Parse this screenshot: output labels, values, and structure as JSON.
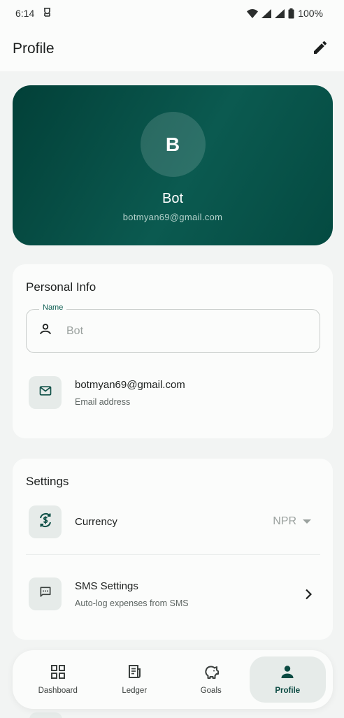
{
  "status_bar": {
    "time": "6:14",
    "battery": "100%"
  },
  "app_bar": {
    "title": "Profile"
  },
  "profile": {
    "avatar_initial": "B",
    "name": "Bot",
    "email": "botmyan69@gmail.com"
  },
  "personal_info": {
    "title": "Personal Info",
    "name_field": {
      "label": "Name",
      "placeholder": "Bot"
    },
    "email_row": {
      "value": "botmyan69@gmail.com",
      "caption": "Email address"
    }
  },
  "settings": {
    "title": "Settings",
    "currency": {
      "label": "Currency",
      "value": "NPR"
    },
    "sms": {
      "label": "SMS Settings",
      "caption": "Auto-log expenses from SMS"
    }
  },
  "bottom_nav": {
    "items": [
      {
        "label": "Dashboard",
        "icon": "grid-icon"
      },
      {
        "label": "Ledger",
        "icon": "receipt-icon"
      },
      {
        "label": "Goals",
        "icon": "piggy-bank-icon"
      },
      {
        "label": "Profile",
        "icon": "person-icon",
        "active": true
      }
    ]
  },
  "colors": {
    "accent": "#0b5a50",
    "hero_dark": "#024038",
    "background": "#f2f4f3",
    "card": "#fbfcfb"
  }
}
